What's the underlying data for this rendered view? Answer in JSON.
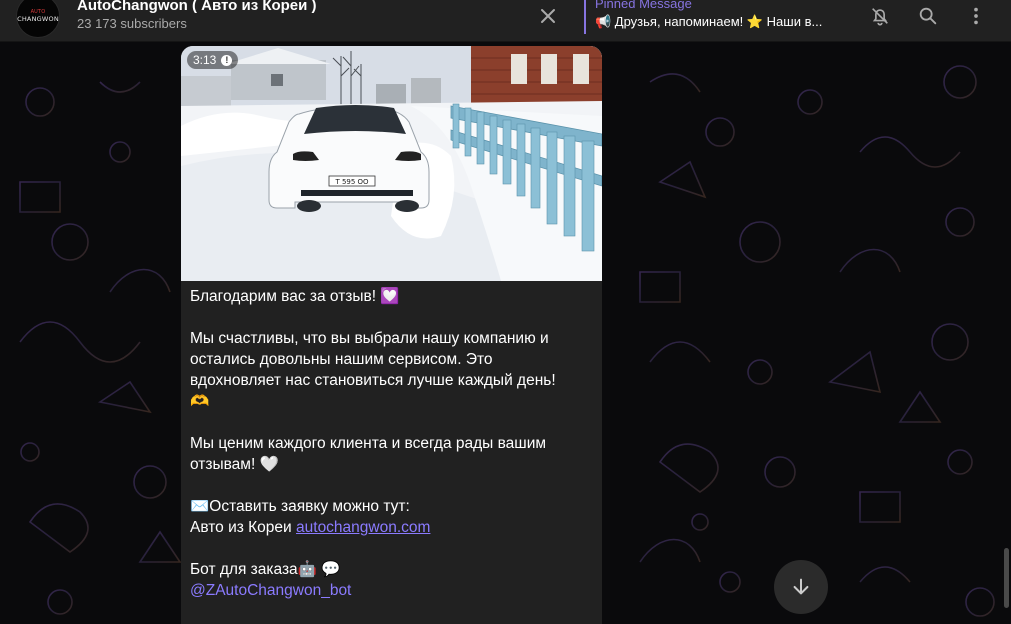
{
  "header": {
    "avatar_text_top": "AUTO",
    "avatar_text": "CHANGWON",
    "title": "AutoChangwon ( Авто из Кореи )",
    "subscribers": "23 173 subscribers"
  },
  "pinned": {
    "label": "Pinned Message",
    "text": "📢 Друзья, напоминаем! ⭐ Наши в..."
  },
  "icons": {
    "close": "close-icon",
    "mute": "bell-off-icon",
    "search": "search-icon",
    "more": "more-vertical-icon",
    "scroll": "arrow-down-icon"
  },
  "video": {
    "duration": "3:13",
    "plate": "Т 595 ОО"
  },
  "message": {
    "line1": "Благодарим вас за отзыв! 💟",
    "p2_l1": "Мы счастливы, что вы выбрали нашу компанию и",
    "p2_l2": "остались довольны нашим сервисом. Это",
    "p2_l3": "вдохновляет нас становиться лучше каждый день!",
    "p2_l4": "🫶",
    "p3_l1": "Мы ценим каждого клиента и всегда рады вашим",
    "p3_l2": "отзывам! 🤍",
    "p4_l1": "✉️Оставить заявку можно тут:",
    "p4_l2_prefix": "Авто из Кореи ",
    "p4_link": "autochangwon.com",
    "p5_l1": "Бот для заказа🤖  💬",
    "p5_mention": "@ZAutoChangwon_bot"
  },
  "colors": {
    "accent": "#8774e1",
    "link": "#8b7bff",
    "header_bg": "#212121",
    "bubble_bg": "#212121"
  }
}
